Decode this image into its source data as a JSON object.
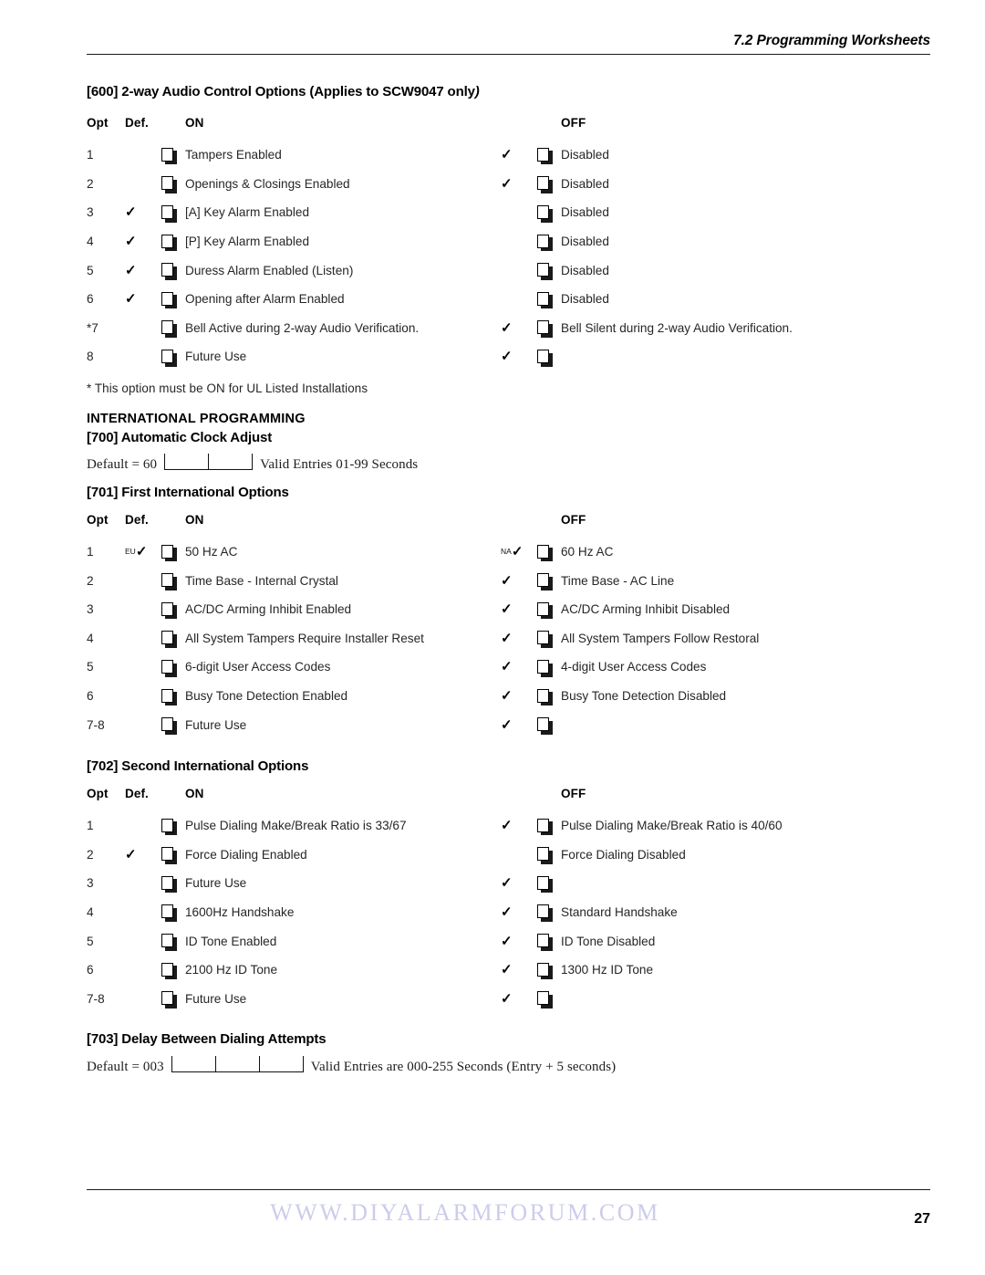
{
  "header": {
    "title": "7.2 Programming Worksheets"
  },
  "section600": {
    "title_main": "[600] 2-way Audio Control Options (Applies to SCW9047 only",
    "title_tail": ")",
    "columns": {
      "opt": "Opt",
      "def": "Def.",
      "on": "ON",
      "off": "OFF"
    },
    "rows": [
      {
        "opt": "1",
        "on_def": "",
        "on_label": "Tampers Enabled",
        "off_def": "check",
        "off_label": "Disabled"
      },
      {
        "opt": "2",
        "on_def": "",
        "on_label": "Openings & Closings Enabled",
        "off_def": "check",
        "off_label": "Disabled"
      },
      {
        "opt": "3",
        "on_def": "check",
        "on_label": "[A] Key Alarm Enabled",
        "off_def": "",
        "off_label": "Disabled"
      },
      {
        "opt": "4",
        "on_def": "check",
        "on_label": "[P] Key Alarm Enabled",
        "off_def": "",
        "off_label": "Disabled"
      },
      {
        "opt": "5",
        "on_def": "check",
        "on_label": "Duress Alarm Enabled (Listen)",
        "off_def": "",
        "off_label": "Disabled"
      },
      {
        "opt": "6",
        "on_def": "check",
        "on_label": "Opening after Alarm Enabled",
        "off_def": "",
        "off_label": "Disabled"
      },
      {
        "opt": "*7",
        "on_def": "",
        "on_label": "Bell Active during 2-way Audio Verification.",
        "off_def": "check",
        "off_label": "Bell Silent during 2-way Audio Verification."
      },
      {
        "opt": "8",
        "on_def": "",
        "on_label": "Future Use",
        "off_def": "check",
        "off_label": ""
      }
    ],
    "footnote": "* This option must be ON for UL Listed Installations"
  },
  "international": {
    "heading": "INTERNATIONAL PROGRAMMING"
  },
  "section700": {
    "title": "[700] Automatic Clock Adjust",
    "default_label": "Default = 60",
    "cells": 2,
    "valid_entries": "Valid Entries 01-99 Seconds"
  },
  "section701": {
    "title": "[701] First International Options",
    "columns": {
      "opt": "Opt",
      "def": "Def.",
      "on": "ON",
      "off": "OFF"
    },
    "rows": [
      {
        "opt": "1",
        "on_def": "check",
        "on_region": "EU",
        "on_label": "50 Hz AC",
        "off_def": "check",
        "off_region": "NA",
        "off_label": "60 Hz AC"
      },
      {
        "opt": "2",
        "on_def": "",
        "on_region": "",
        "on_label": "Time Base - Internal Crystal",
        "off_def": "check",
        "off_region": "",
        "off_label": "Time Base - AC Line"
      },
      {
        "opt": "3",
        "on_def": "",
        "on_region": "",
        "on_label": "AC/DC Arming Inhibit Enabled",
        "off_def": "check",
        "off_region": "",
        "off_label": "AC/DC Arming Inhibit Disabled"
      },
      {
        "opt": "4",
        "on_def": "",
        "on_region": "",
        "on_label": "All System Tampers Require Installer Reset",
        "off_def": "check",
        "off_region": "",
        "off_label": "All System Tampers Follow Restoral"
      },
      {
        "opt": "5",
        "on_def": "",
        "on_region": "",
        "on_label": "6-digit User Access Codes",
        "off_def": "check",
        "off_region": "",
        "off_label": "4-digit User Access Codes"
      },
      {
        "opt": "6",
        "on_def": "",
        "on_region": "",
        "on_label": "Busy Tone Detection Enabled",
        "off_def": "check",
        "off_region": "",
        "off_label": "Busy Tone Detection Disabled"
      },
      {
        "opt": "7-8",
        "on_def": "",
        "on_region": "",
        "on_label": "Future Use",
        "off_def": "check",
        "off_region": "",
        "off_label": ""
      }
    ]
  },
  "section702": {
    "title": "[702] Second International Options",
    "columns": {
      "opt": "Opt",
      "def": "Def.",
      "on": "ON",
      "off": "OFF"
    },
    "rows": [
      {
        "opt": "1",
        "on_def": "",
        "on_label": "Pulse Dialing Make/Break Ratio is 33/67",
        "off_def": "check",
        "off_label": "Pulse Dialing Make/Break Ratio is 40/60"
      },
      {
        "opt": "2",
        "on_def": "check",
        "on_label": "Force Dialing Enabled",
        "off_def": "",
        "off_label": "Force Dialing Disabled"
      },
      {
        "opt": "3",
        "on_def": "",
        "on_label": "Future Use",
        "off_def": "check",
        "off_label": ""
      },
      {
        "opt": "4",
        "on_def": "",
        "on_label": "1600Hz Handshake",
        "off_def": "check",
        "off_label": "Standard Handshake"
      },
      {
        "opt": "5",
        "on_def": "",
        "on_label": "ID Tone Enabled",
        "off_def": "check",
        "off_label": "ID Tone Disabled"
      },
      {
        "opt": "6",
        "on_def": "",
        "on_label": "2100 Hz ID Tone",
        "off_def": "check",
        "off_label": "1300 Hz ID Tone"
      },
      {
        "opt": "7-8",
        "on_def": "",
        "on_label": "Future Use",
        "off_def": "check",
        "off_label": ""
      }
    ]
  },
  "section703": {
    "title": "[703] Delay Between Dialing Attempts",
    "default_label": "Default = 003",
    "cells": 3,
    "valid_entries": "Valid Entries are 000-255 Seconds (Entry + 5 seconds)"
  },
  "footer": {
    "watermark": "WWW.DIYALARMFORUM.COM",
    "page_number": "27"
  },
  "glyphs": {
    "check": "✓"
  }
}
